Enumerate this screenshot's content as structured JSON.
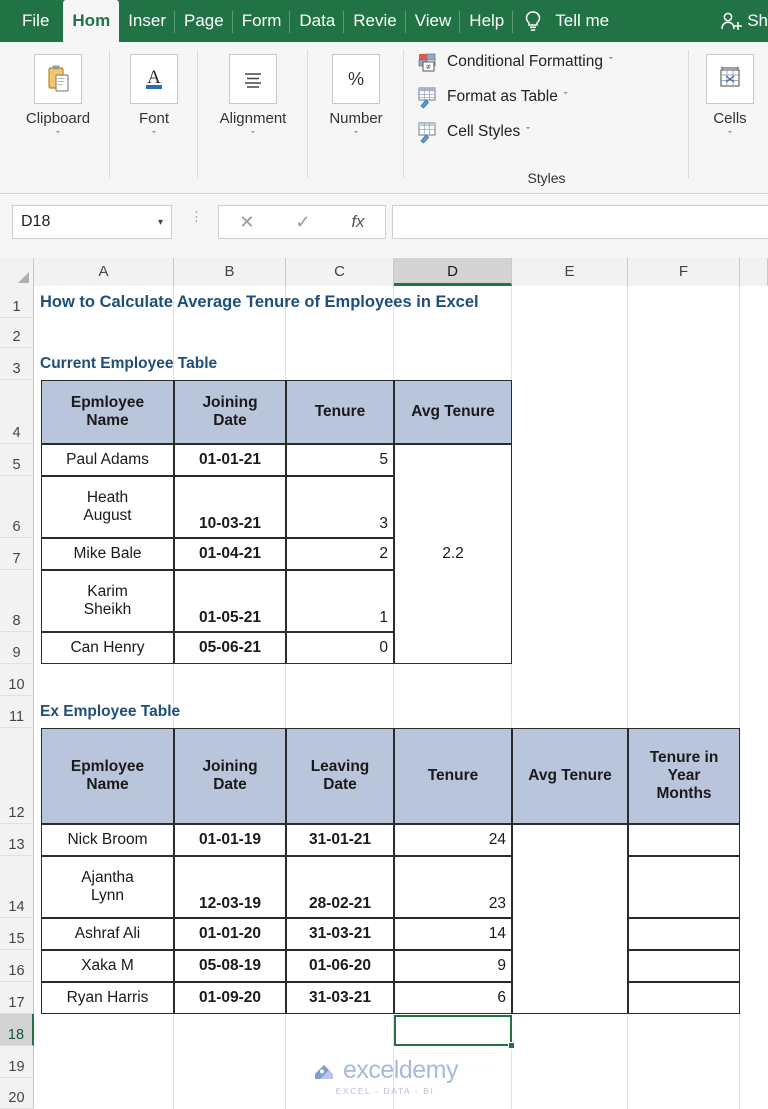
{
  "ribbon": {
    "tabs": [
      {
        "label": "File",
        "active": false
      },
      {
        "label": "Hom",
        "active": true
      },
      {
        "label": "Inser",
        "active": false
      },
      {
        "label": "Page",
        "active": false
      },
      {
        "label": "Form",
        "active": false
      },
      {
        "label": "Data",
        "active": false
      },
      {
        "label": "Revie",
        "active": false
      },
      {
        "label": "View",
        "active": false
      },
      {
        "label": "Help",
        "active": false
      }
    ],
    "tell_me": "Tell me",
    "share": "Sh",
    "groups": [
      {
        "label": "Clipboard",
        "icon": "clipboard-icon"
      },
      {
        "label": "Font",
        "icon": "font-icon"
      },
      {
        "label": "Alignment",
        "icon": "alignment-icon"
      },
      {
        "label": "Number",
        "icon": "percent-icon"
      },
      {
        "label": "Cells",
        "icon": "cells-icon"
      }
    ],
    "styles": {
      "caption": "Styles",
      "items": [
        {
          "label": "Conditional Formatting",
          "icon": "conditional-formatting-icon",
          "dropdown": "ˇ"
        },
        {
          "label": "Format as Table",
          "icon": "format-as-table-icon",
          "dropdown": "ˇ"
        },
        {
          "label": "Cell Styles",
          "icon": "cell-styles-icon",
          "dropdown": "ˇ"
        }
      ]
    },
    "group_chevron": "ˇ"
  },
  "formula_bar": {
    "name_box_value": "D18",
    "name_box_arrow": "▾",
    "cancel": "✕",
    "enter": "✓",
    "fx": "fx",
    "formula_value": ""
  },
  "grid": {
    "columns": [
      "A",
      "B",
      "C",
      "D",
      "E",
      "F"
    ],
    "selected_column": "D",
    "rows": [
      "1",
      "2",
      "3",
      "4",
      "5",
      "6",
      "7",
      "8",
      "9",
      "10",
      "11",
      "12",
      "13",
      "14",
      "15",
      "16",
      "17",
      "18",
      "19",
      "20"
    ],
    "selected_row": "18",
    "selected_cell": "D18"
  },
  "sheet": {
    "title": "How to Calculate Average Tenure of Employees in Excel",
    "table1": {
      "section_title": "Current Employee Table",
      "headers": [
        "Epmloyee Name",
        "Joining Date",
        "Tenure",
        "Avg Tenure"
      ],
      "header_lines": [
        [
          "Epmloyee",
          "Name"
        ],
        [
          "Joining",
          "Date"
        ],
        [
          "Tenure"
        ],
        [
          "Avg Tenure"
        ]
      ],
      "rows": [
        {
          "name_lines": [
            "Paul Adams"
          ],
          "join": "01-01-21",
          "tenure": "5"
        },
        {
          "name_lines": [
            "Heath",
            "August"
          ],
          "join": "10-03-21",
          "tenure": "3"
        },
        {
          "name_lines": [
            "Mike Bale"
          ],
          "join": "01-04-21",
          "tenure": "2"
        },
        {
          "name_lines": [
            "Karim",
            "Sheikh"
          ],
          "join": "01-05-21",
          "tenure": "1"
        },
        {
          "name_lines": [
            "Can Henry"
          ],
          "join": "05-06-21",
          "tenure": "0"
        }
      ],
      "avg_tenure": "2.2"
    },
    "table2": {
      "section_title": "Ex Employee Table",
      "headers": [
        "Epmloyee Name",
        "Joining Date",
        "Leaving Date",
        "Tenure",
        "Avg Tenure",
        "Tenure in Year Months"
      ],
      "header_lines": [
        [
          "Epmloyee",
          "Name"
        ],
        [
          "Joining",
          "Date"
        ],
        [
          "Leaving",
          "Date"
        ],
        [
          "Tenure"
        ],
        [
          "Avg Tenure"
        ],
        [
          "Tenure in",
          "Year",
          "Months"
        ]
      ],
      "rows": [
        {
          "name_lines": [
            "Nick Broom"
          ],
          "join": "01-01-19",
          "leave": "31-01-21",
          "tenure": "24",
          "year_months": ""
        },
        {
          "name_lines": [
            "Ajantha",
            "Lynn"
          ],
          "join": "12-03-19",
          "leave": "28-02-21",
          "tenure": "23",
          "year_months": ""
        },
        {
          "name_lines": [
            "Ashraf Ali"
          ],
          "join": "01-01-20",
          "leave": "31-03-21",
          "tenure": "14",
          "year_months": ""
        },
        {
          "name_lines": [
            "Xaka M"
          ],
          "join": "05-08-19",
          "leave": "01-06-20",
          "tenure": "9",
          "year_months": ""
        },
        {
          "name_lines": [
            "Ryan Harris"
          ],
          "join": "01-09-20",
          "leave": "31-03-21",
          "tenure": "6",
          "year_months": ""
        }
      ],
      "avg_tenure": ""
    }
  },
  "watermark": {
    "brand": "exceldemy",
    "tagline": "EXCEL - DATA - BI"
  },
  "colors": {
    "ribbon_green": "#217346",
    "table_header_fill": "#b9c5da",
    "title_text": "#1f4e79",
    "selection_green": "#217346"
  }
}
